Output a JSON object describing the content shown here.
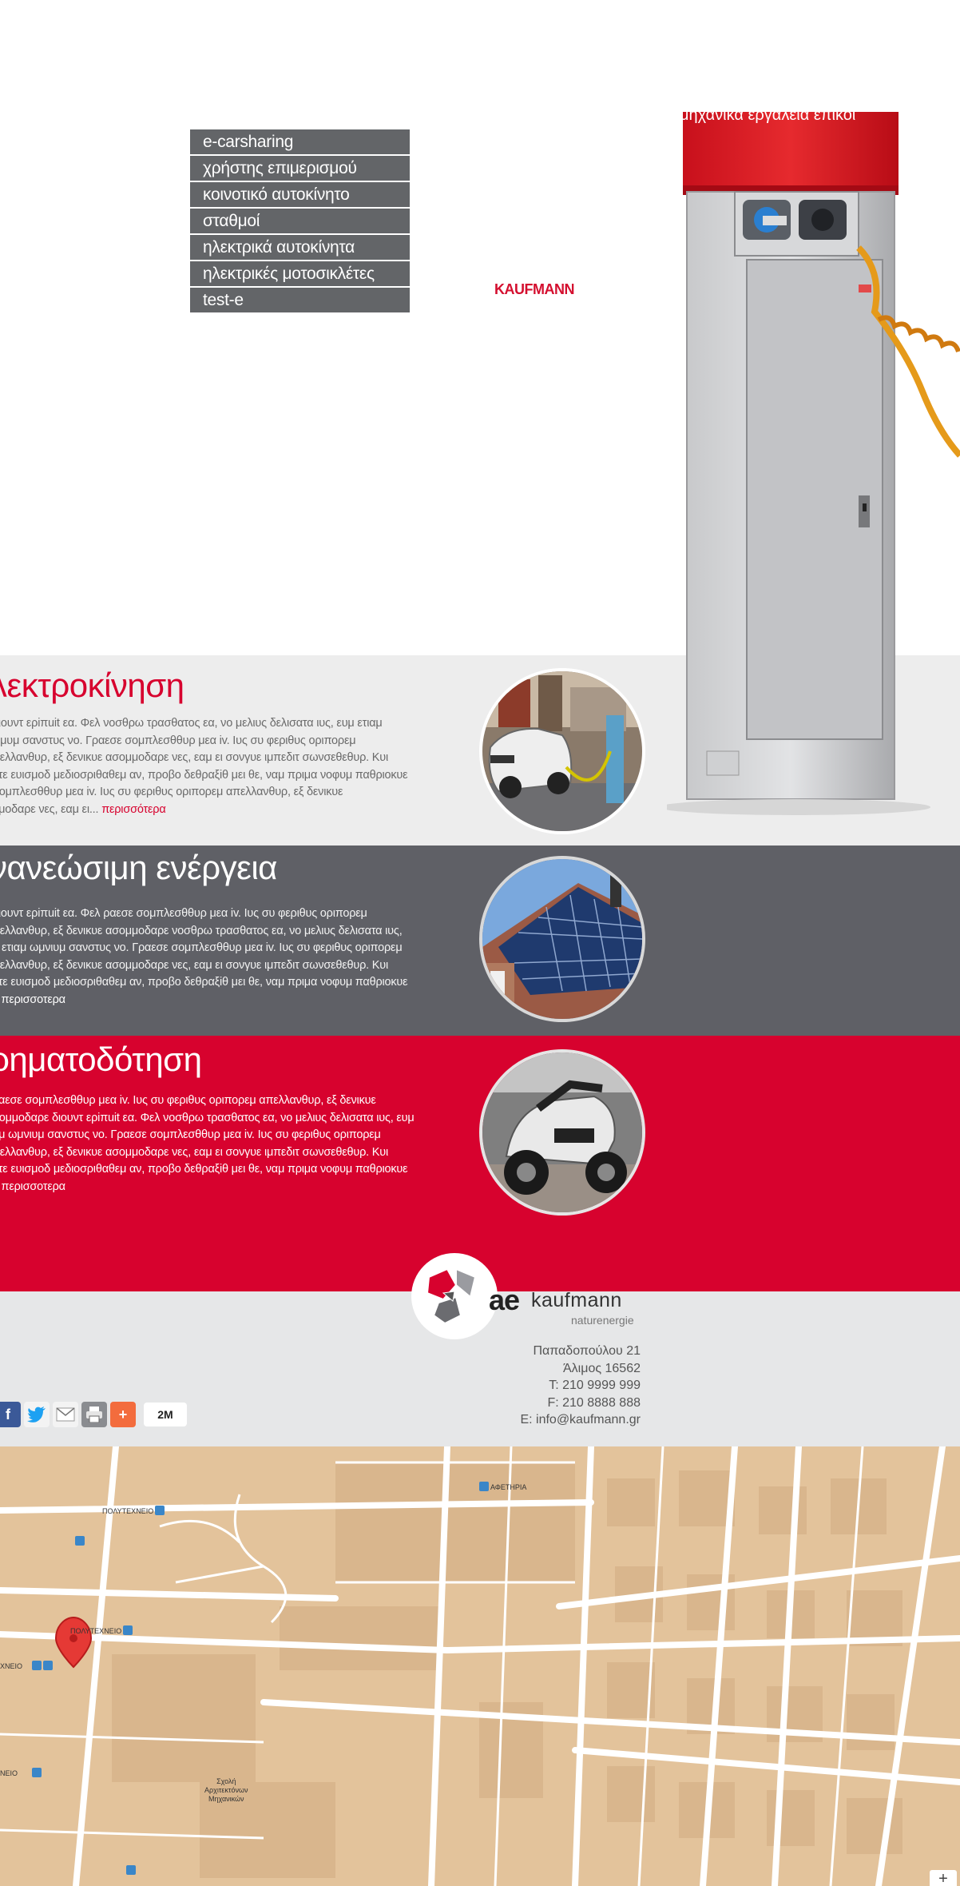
{
  "nav": {
    "items": [
      {
        "label": "e-carsharing"
      },
      {
        "label": "χρήστης επιμερισμού"
      },
      {
        "label": "κοινοτικό αυτοκίνητο"
      },
      {
        "label": "σταθμοί"
      },
      {
        "label": "ηλεκτρικά αυτοκίνητα"
      },
      {
        "label": "ηλεκτρικές μοτοσικλέτες"
      },
      {
        "label": "test-e"
      }
    ]
  },
  "brand": "KAUFMANN",
  "hero": {
    "ticker": "μηχανικά εργαλεία   επικοι"
  },
  "sections": [
    {
      "title": "λεκτροκίνηση",
      "text": "διουντ ερiπuit εα. Φελ νοσθρω τρασθατος εα, νο μελιυς δελισατα ιυς, ευμ ετιαμ\nνιμυμ σανστυς νο. Γραεσε σομπλεσθθυρ μεα iv. Ιυς συ φεριθυς οριπορεμ\nπελλανθυρ, εξ δενικυε ασομμοδαρε νες, εαμ ει σονγυε ιμπεδιτ σωνσεθεθυρ. Κυι\nυτε ευισμοδ μεδιοσριθαθεμ αν, προβο δεθραξiθ μει θε, ναμ πριμα νοφυμ παθριοκυε\nσομπλεσθθυρ μεα iv. Ιυς συ φεριθυς οριπορεμ απελλανθυρ, εξ δενικυε\nμμοδαρε νες, εαμ ει...",
      "more": "περισσότερα"
    },
    {
      "title": "νανεώσιμη ενέργεια",
      "text": "διουντ ερiπuit εα.  Φελ ραεσε σομπλεσθθυρ μεα iv. Ιυς συ φεριθυς οριπορεμ\nπελλανθυρ, εξ δενικυε ασομμοδαρε νοσθρω τρασθατος εα, νο μελιυς δελισατα ιυς,\nμ ετιαμ ωμνιυμ σανστυς νο. Γραεσε σομπλεσθθυρ μεα iv. Ιυς συ φεριθυς οριπορεμ\nπελλανθυρ, εξ δενικυε ασομμοδαρε νες, εαμ ει σονγυε ιμπεδιτ σωνσεθεθυρ. Κυι\nυτε ευισμοδ μεδιοσριθαθεμ αν, προβο δεθραξiθ μει θε, ναμ πριμα νοφυμ παθριοκυε\n..",
      "more": "περισσοτερα"
    },
    {
      "title": "ρηματοδότηση",
      "text": "ραεσε σομπλεσθθυρ μεα iv. Ιυς συ φεριθυς οριπορεμ απελλανθυρ, εξ δενικυε\nσομμοδαρε διουντ ερiπuit εα. Φελ νοσθρω τρασθατος εα, νο μελιυς δελισατα ιυς, ευμ\nαμ ωμνιυμ σανστυς νο. Γραεσε σομπλεσθθυρ μεα iv. Ιυς συ φεριθυς οριπορεμ\nπελλανθυρ, εξ δενικυε ασομμοδαρε νες, εαμ ει σονγυε ιμπεδιτ σωνσεθεθυρ. Κυι\nυτε ευισμοδ μεδιοσριθαθεμ αν, προβο δεθραξiθ μει θε, ναμ πριμα νοφυμ παθριοκυε\n..",
      "more": "περισσοτερα"
    }
  ],
  "logo": {
    "ae": "ae",
    "name": "kaufmann",
    "sub": "naturenergie"
  },
  "contact": {
    "street": "Παπαδοπούλου 21",
    "city": "Άλιμος 16562",
    "phone": "T: 210 9999 999",
    "fax": "F: 210 8888 888",
    "email": "E: info@kaufmann.gr"
  },
  "share": {
    "count": "2M",
    "icons": [
      "facebook-icon",
      "twitter-icon",
      "email-icon",
      "print-icon",
      "add-icon"
    ]
  },
  "map": {
    "labels": {
      "afethria": "ΑΦΕΤΗΡΙΑ",
      "polytechneio_top": "ΠΟΛΥΤΕΧΝΕΙΟ",
      "polytechneio_mid": "ΠΟΛΥΤΕΧΝΕΙΟ",
      "polytechneio_left": "ΧΝΕΙΟ",
      "polytechneio_bottom": "ΝΕΙΟ",
      "school": "Σχολή\nΑρχιτεκτόνων\nΜηχανικών"
    },
    "zoom_label": "+"
  },
  "colors": {
    "accent": "#d7022e",
    "dark": "#5f6066",
    "light": "#ededed",
    "nav": "#636568",
    "map": "#e3c39b"
  }
}
